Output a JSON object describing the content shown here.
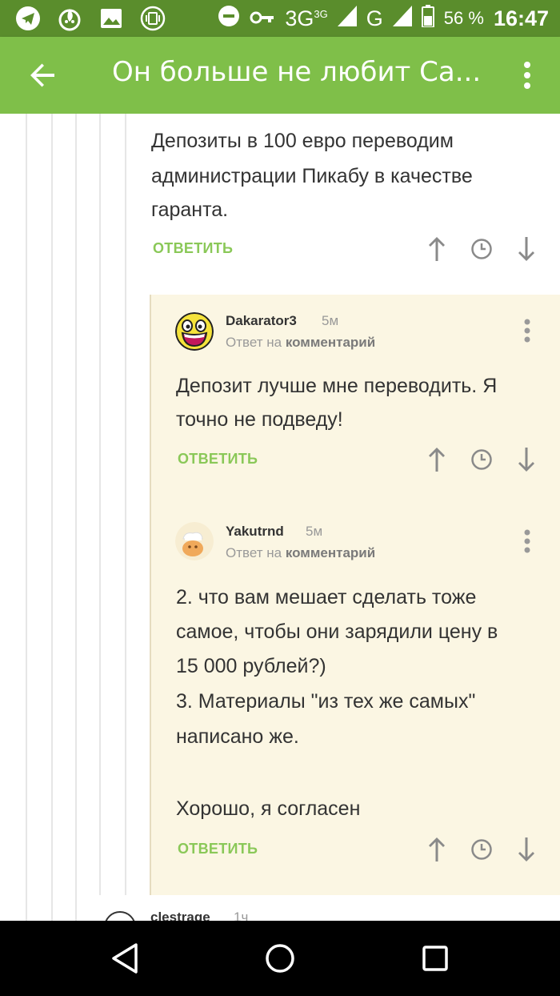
{
  "status_bar": {
    "network": "3G",
    "network_small": "3G",
    "network2": "G",
    "battery": "56 %",
    "time": "16:47",
    "left_icons": [
      "telegram-icon",
      "fire-app-icon",
      "image-icon",
      "vibrate-icon"
    ],
    "right_icons": [
      "do-not-disturb-icon",
      "vpn-key-icon",
      "signal-icon",
      "battery-icon"
    ]
  },
  "app_bar": {
    "title": "Он больше не любит Са...",
    "back_icon": "arrow-back-icon",
    "menu_icon": "more-vert-icon"
  },
  "comments": [
    {
      "text_lines": [
        "Депозиты в 100 евро переводим",
        "администрации Пикабу в качестве",
        "гаранта."
      ],
      "reply_label": "ОТВЕТИТЬ"
    },
    {
      "username": "Dakarator3",
      "time": "5м",
      "reply_to_prefix": "Ответ на",
      "reply_to_link": "комментарий",
      "text_lines": [
        "Депозит лучше мне переводить. Я",
        "точно не подведу!"
      ],
      "reply_label": "ОТВЕТИТЬ"
    },
    {
      "username": "Yakutrnd",
      "time": "5м",
      "reply_to_prefix": "Ответ на",
      "reply_to_link": "комментарий",
      "text_lines": [
        "2. что вам мешает сделать тоже",
        "самое, чтобы они зарядили цену в",
        "15 000 рублей?)",
        "3. Материалы \"из тех же самых\"",
        "написано же.",
        "",
        "Хорошо, я согласен"
      ],
      "reply_label": "ОТВЕТИТЬ"
    }
  ],
  "next_comment_peek": {
    "username": "clestrage",
    "time": "1ч"
  },
  "colors": {
    "status_bar": "#5a8d2c",
    "app_bar": "#7fbf49",
    "reply_green": "#8ac858",
    "highlight_bg": "#fbf6e3"
  }
}
